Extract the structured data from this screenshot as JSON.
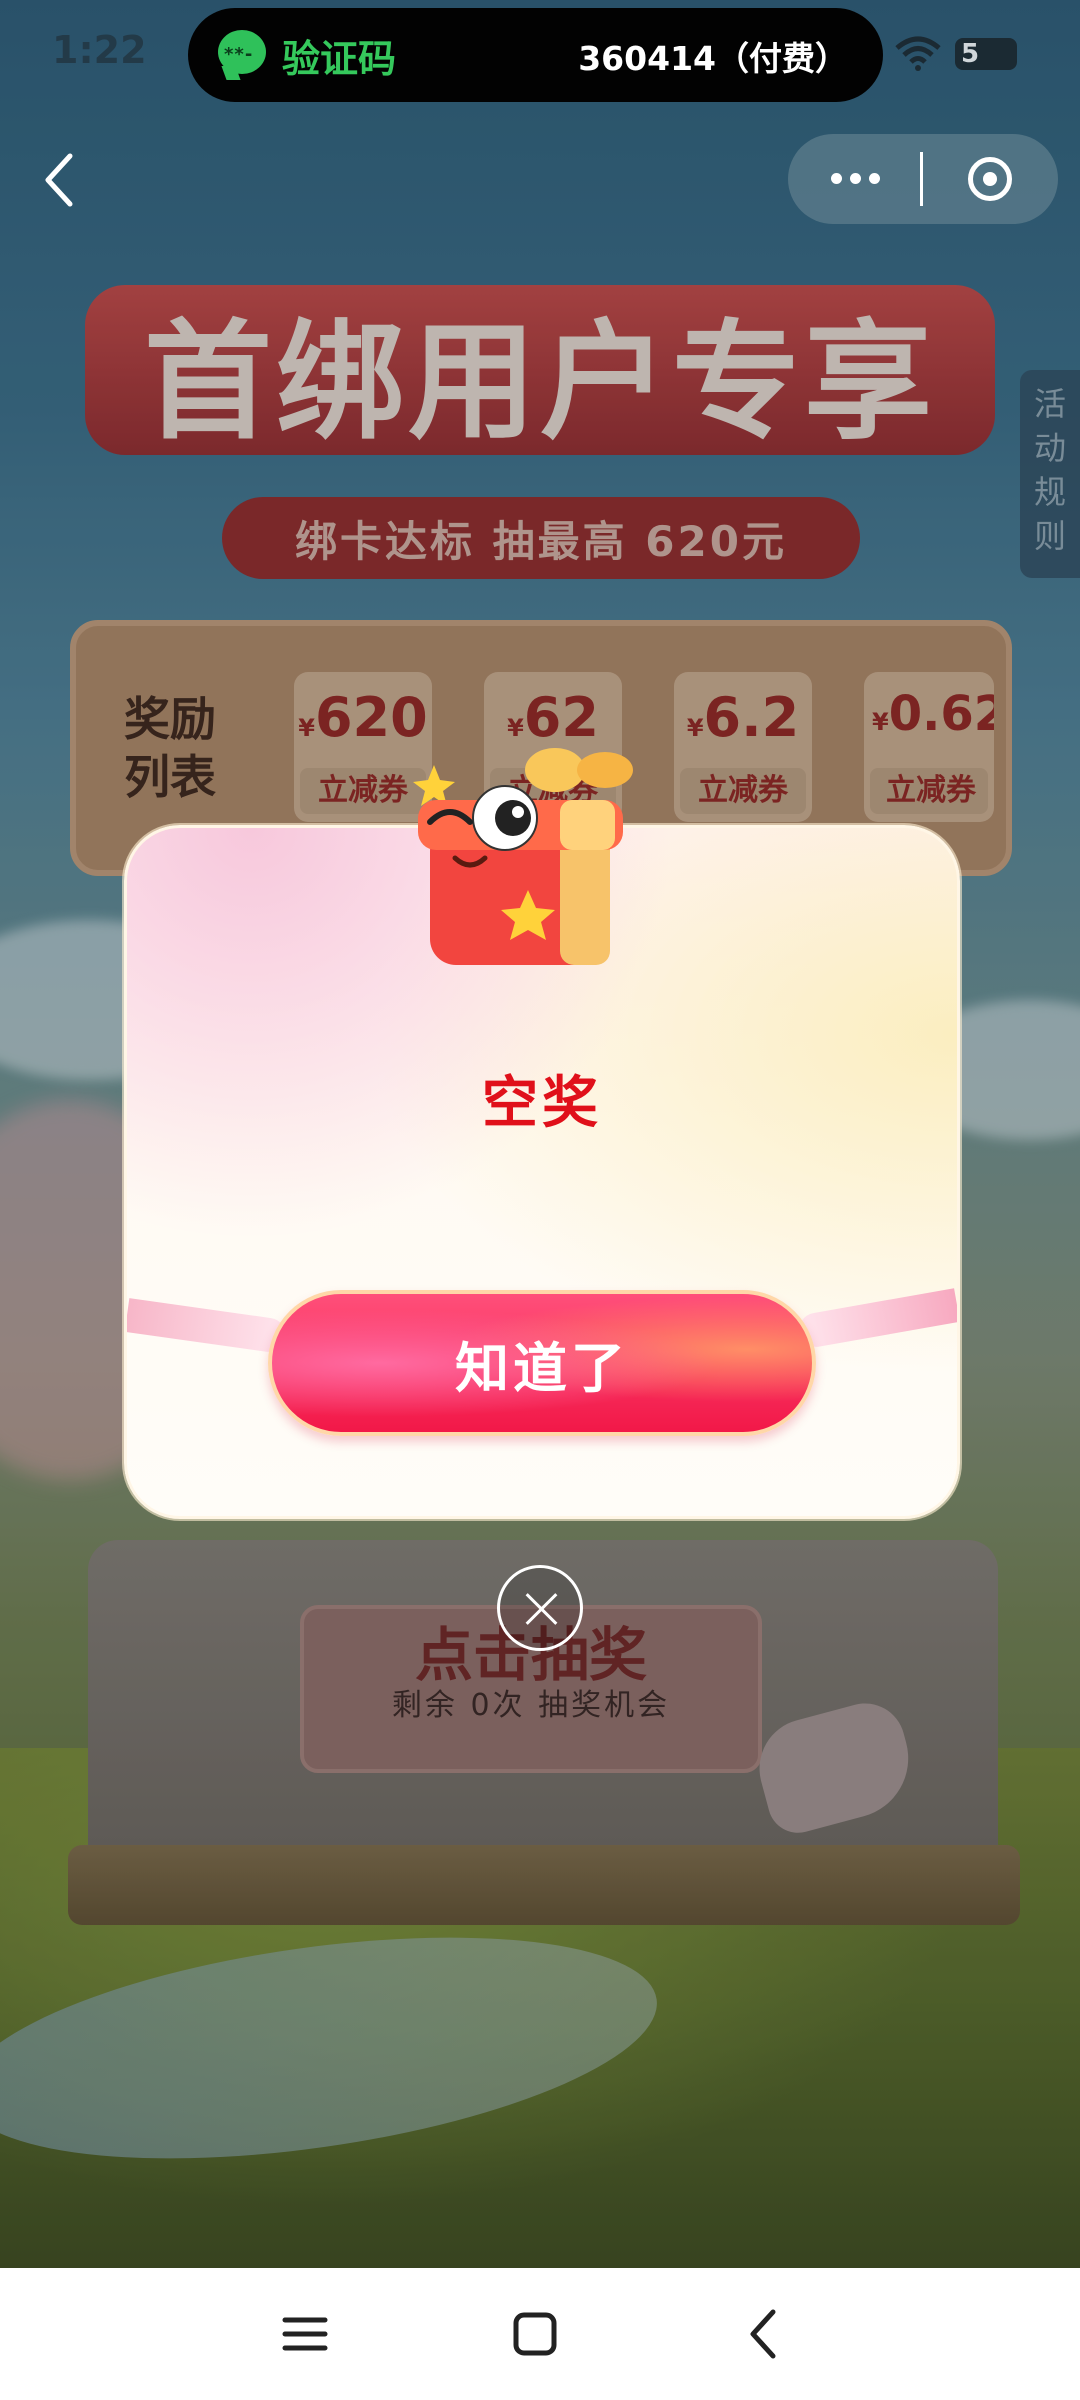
{
  "status_bar": {
    "time": "1:22",
    "notification": {
      "app": "验证码",
      "icon_dots": "**-",
      "code": "360414（付费）"
    },
    "battery": "5"
  },
  "header": {
    "back_icon": "chevron-left-icon",
    "capsule": {
      "more_icon": "more-dots-icon",
      "close_icon": "close-circle-icon"
    }
  },
  "page": {
    "title": "首绑用户专享",
    "subtitle": "绑卡达标 抽最高 620元",
    "side_tab": "活动规则",
    "reward": {
      "title": "奖励列表",
      "items": [
        {
          "currency": "¥",
          "amount": "620",
          "label": "立减券"
        },
        {
          "currency": "¥",
          "amount": "62",
          "label": "立减券"
        },
        {
          "currency": "¥",
          "amount": "6.2",
          "label": "立减券"
        },
        {
          "currency": "¥",
          "amount": "0.62",
          "label": "立减券"
        }
      ]
    },
    "draw": {
      "button": "点击抽奖",
      "remaining": "剩余 0次 抽奖机会"
    }
  },
  "modal": {
    "result": "空奖",
    "ok_button": "知道了",
    "mascot": "gift-mascot-icon",
    "close_icon": "close-icon"
  },
  "nav_bar": {
    "menu_icon": "menu-icon",
    "home_icon": "home-square-icon",
    "back_icon": "back-triangle-icon"
  },
  "colors": {
    "accent_red": "#e0101a",
    "button_pink": "#f21848",
    "notify_green": "#35c95c"
  }
}
